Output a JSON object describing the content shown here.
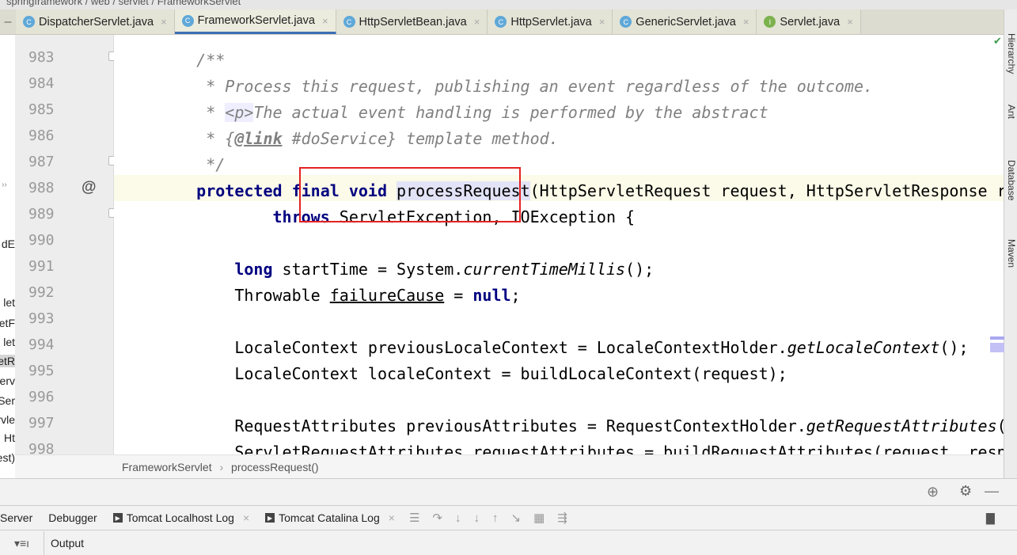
{
  "breadcrumb_top": "springframework / web / servlet / FrameworkServlet",
  "tabs": [
    {
      "label": "DispatcherServlet.java",
      "icon": "class-icon",
      "active": false
    },
    {
      "label": "FrameworkServlet.java",
      "icon": "class-icon",
      "active": true
    },
    {
      "label": "HttpServletBean.java",
      "icon": "class-icon",
      "active": false
    },
    {
      "label": "HttpServlet.java",
      "icon": "class-icon",
      "active": false
    },
    {
      "label": "GenericServlet.java",
      "icon": "class-icon",
      "active": false
    },
    {
      "label": "Servlet.java",
      "icon": "interface-icon",
      "active": false
    }
  ],
  "left_fragments": [
    "dE",
    "let",
    "etF",
    "let",
    "etR",
    "erv",
    "Ser",
    "rvle",
    "Ht",
    "est)"
  ],
  "line_numbers": [
    "983",
    "984",
    "985",
    "986",
    "987",
    "988",
    "989",
    "990",
    "991",
    "992",
    "993",
    "994",
    "995",
    "996",
    "997",
    "998"
  ],
  "gutter_annotation": "@",
  "code_lines": [
    [
      [
        "c",
        "    /**"
      ]
    ],
    [
      [
        "c",
        "     * Process this request, publishing an event regardless of the outcome."
      ]
    ],
    [
      [
        "c",
        "     * "
      ],
      [
        "tagc",
        "<p>"
      ],
      [
        "c",
        "The actual event handling is performed by the abstract"
      ]
    ],
    [
      [
        "c",
        "     * {"
      ],
      [
        "ct",
        "@link"
      ],
      [
        "c",
        " #doService} template method."
      ]
    ],
    [
      [
        "c",
        "     */"
      ]
    ],
    [
      [
        "k",
        "    protected final void "
      ],
      [
        "sel",
        "processRequest"
      ],
      [
        "n",
        "(HttpServletRequest request, HttpServletResponse response)"
      ]
    ],
    [
      [
        "n",
        "            "
      ],
      [
        "k",
        "throws"
      ],
      [
        "n",
        " ServletException, IOException {"
      ]
    ],
    [
      [
        "n",
        ""
      ]
    ],
    [
      [
        "n",
        "        "
      ],
      [
        "k",
        "long"
      ],
      [
        "n",
        " startTime = System."
      ],
      [
        "it",
        "currentTimeMillis"
      ],
      [
        "n",
        "();"
      ]
    ],
    [
      [
        "n",
        "        Throwable "
      ],
      [
        "ul",
        "failureCause"
      ],
      [
        "n",
        " = "
      ],
      [
        "k",
        "null"
      ],
      [
        "n",
        ";"
      ]
    ],
    [
      [
        "n",
        ""
      ]
    ],
    [
      [
        "n",
        "        LocaleContext previousLocaleContext = LocaleContextHolder."
      ],
      [
        "it",
        "getLocaleContext"
      ],
      [
        "n",
        "();"
      ]
    ],
    [
      [
        "n",
        "        LocaleContext localeContext = buildLocaleContext(request);"
      ]
    ],
    [
      [
        "n",
        ""
      ]
    ],
    [
      [
        "n",
        "        RequestAttributes previousAttributes = RequestContextHolder."
      ],
      [
        "it",
        "getRequestAttributes"
      ],
      [
        "n",
        "();"
      ]
    ],
    [
      [
        "n",
        "        ServletRequestAttributes requestAttributes = buildRequestAttributes(request, response, previousAttributes);"
      ]
    ]
  ],
  "right_tools": [
    "Hierarchy",
    "Ant",
    "Database",
    "Maven"
  ],
  "editor_breadcrumb": {
    "class": "FrameworkServlet",
    "separator": "›",
    "method": "processRequest()"
  },
  "bottom_tabs": [
    {
      "label": "Server",
      "icon": ""
    },
    {
      "label": "Debugger",
      "icon": ""
    },
    {
      "label": "Tomcat Localhost Log",
      "icon": "log-icon",
      "closable": true
    },
    {
      "label": "Tomcat Catalina Log",
      "icon": "log-icon",
      "closable": true
    }
  ],
  "output_label": "Output",
  "colors": {
    "keyword": "#000080",
    "comment": "#808080",
    "highlight_box": "#e32222",
    "active_tab_underline": "#3d6fb4"
  }
}
